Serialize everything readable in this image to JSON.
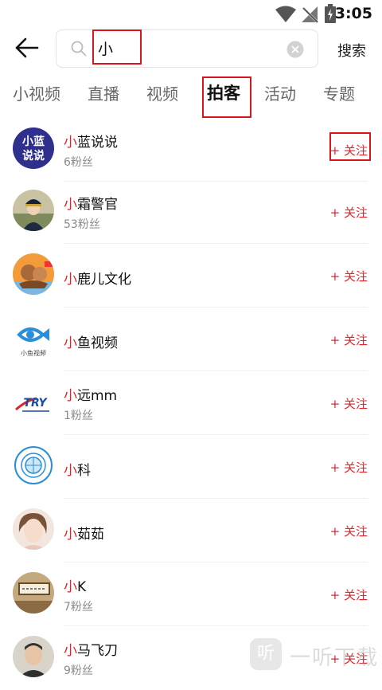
{
  "status_bar": {
    "time": "3:05"
  },
  "search": {
    "query": "小",
    "button_label": "搜索"
  },
  "tabs": [
    {
      "label": "小视频"
    },
    {
      "label": "直播"
    },
    {
      "label": "视频"
    },
    {
      "label": "拍客"
    },
    {
      "label": "活动"
    },
    {
      "label": "专题"
    }
  ],
  "active_tab": "拍客",
  "results": [
    {
      "highlight": "小",
      "rest": "蓝说说",
      "fans": "6粉丝",
      "follow": "+ 关注",
      "avatar_text": "小蓝说说"
    },
    {
      "highlight": "小",
      "rest": "霜警官",
      "fans": "53粉丝",
      "follow": "+ 关注"
    },
    {
      "highlight": "小",
      "rest": "鹿儿文化",
      "fans": "",
      "follow": "+ 关注"
    },
    {
      "highlight": "小",
      "rest": "鱼视频",
      "fans": "",
      "follow": "+ 关注",
      "avatar_text": "小鱼视频"
    },
    {
      "highlight": "小",
      "rest": "远mm",
      "fans": "1粉丝",
      "follow": "+ 关注",
      "avatar_text": "TRY"
    },
    {
      "highlight": "小",
      "rest": "科",
      "fans": "",
      "follow": "+ 关注"
    },
    {
      "highlight": "小",
      "rest": "茹茹",
      "fans": "",
      "follow": "+ 关注"
    },
    {
      "highlight": "小",
      "rest": "K",
      "fans": "7粉丝",
      "follow": "+ 关注"
    },
    {
      "highlight": "小",
      "rest": "马飞刀",
      "fans": "9粉丝",
      "follow": "+ 关注"
    }
  ],
  "watermark": {
    "icon_text": "听",
    "text": "一听下载"
  },
  "colors": {
    "accent": "#e0242b",
    "annotation": "#d9141b"
  }
}
